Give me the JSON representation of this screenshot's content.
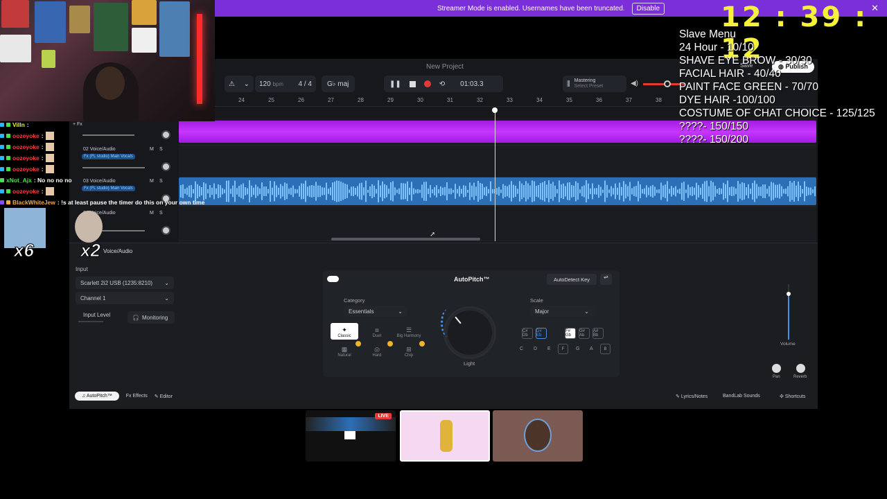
{
  "banner": {
    "text": "Streamer Mode is enabled. Usernames have been truncated.",
    "disable_label": "Disable",
    "close": "✕"
  },
  "timer": "12 : 39 : 12",
  "overlay": {
    "title": "Slave Menu",
    "items": [
      "24 Hour - 10/10",
      "SHAVE EYE BROW - 30/30",
      "FACIAL HAIR - 40/40",
      "PAINT FACE GREEN - 70/70",
      "DYE HAIR -100/100",
      "COSTUME OF CHAT CHOICE - 125/125",
      "????- 150/150",
      "????- 150/200"
    ]
  },
  "project": {
    "name": "New Project",
    "save": "Save",
    "publish": "Publish"
  },
  "transport": {
    "bpm": "120",
    "bpm_unit": "bpm",
    "time_sig": "4 / 4",
    "key": "maj",
    "time": "01:03.3",
    "mastering": "Mastering",
    "mastering_sub": "Select Preset"
  },
  "ruler": [
    "24",
    "25",
    "26",
    "27",
    "28",
    "29",
    "30",
    "31",
    "32",
    "33",
    "34",
    "35",
    "36",
    "37",
    "38"
  ],
  "tracks": [
    {
      "name": "+ Fx"
    },
    {
      "name": "02 Voice/Audio",
      "tag": "Fx (FL studio) Main Vocals",
      "m": "M",
      "s": "S"
    },
    {
      "name": "03 Voice/Audio",
      "tag": "Fx (FL studio) Main Vocals",
      "m": "M",
      "s": "S"
    },
    {
      "name": "04 Voice/Audio",
      "m": "M",
      "s": "S"
    }
  ],
  "chat": [
    {
      "user": "Villn",
      "msg": ":",
      "color": "#f6f23a"
    },
    {
      "user": "oozeyoke",
      "msg": ":",
      "color": "#ff3b3b"
    },
    {
      "user": "oozeyoke",
      "msg": ":",
      "color": "#ff3b3b"
    },
    {
      "user": "oozeyoke",
      "msg": ":",
      "color": "#ff3b3b"
    },
    {
      "user": "oozeyoke",
      "msg": ":",
      "color": "#ff3b3b"
    },
    {
      "user": "xNot_Ajx",
      "msg": ": No no no no",
      "color": "#49e04c"
    },
    {
      "user": "oozeyoke",
      "msg": ":",
      "color": "#ff3b3b"
    },
    {
      "user": "BlackWhiteJew",
      "msg": ": !s at least pause the timer do this on your own time",
      "color": "#f6a93a"
    }
  ],
  "emotes": {
    "x6": "x6",
    "x2": "x2"
  },
  "bottom": {
    "track_label": "Voice/Audio",
    "input_label": "Input",
    "input_device": "Scarlett 2i2 USB (1235:8210)",
    "channel": "Channel 1",
    "input_level": "Input Level",
    "monitoring": "Monitoring"
  },
  "autopitch": {
    "title": "AutoPitch™",
    "autodetect": "AutoDetect Key",
    "category_label": "Category",
    "category_value": "Essentials",
    "scale_label": "Scale",
    "scale_value": "Major",
    "modes": [
      "Classic",
      "Duet",
      "Big Harmony",
      "Natural",
      "Hard",
      "Chip"
    ],
    "knob_label": "Light",
    "accidentals": [
      "C# Db",
      "D# Eb",
      "F# Gb",
      "G# Ab",
      "A# Bb"
    ],
    "notes": [
      "C",
      "D",
      "E",
      "F",
      "G",
      "A",
      "B"
    ]
  },
  "mixer": {
    "volume": "Volume",
    "pan": "Pan",
    "reverb": "Reverb"
  },
  "tabs": {
    "autopitch": "AutoPitch™",
    "effects": "Effects",
    "editor": "Editor",
    "lyrics": "Lyrics/Notes",
    "sounds": "BandLab Sounds",
    "shortcuts": "Shortcuts"
  },
  "thumbs": {
    "live": "LIVE"
  }
}
